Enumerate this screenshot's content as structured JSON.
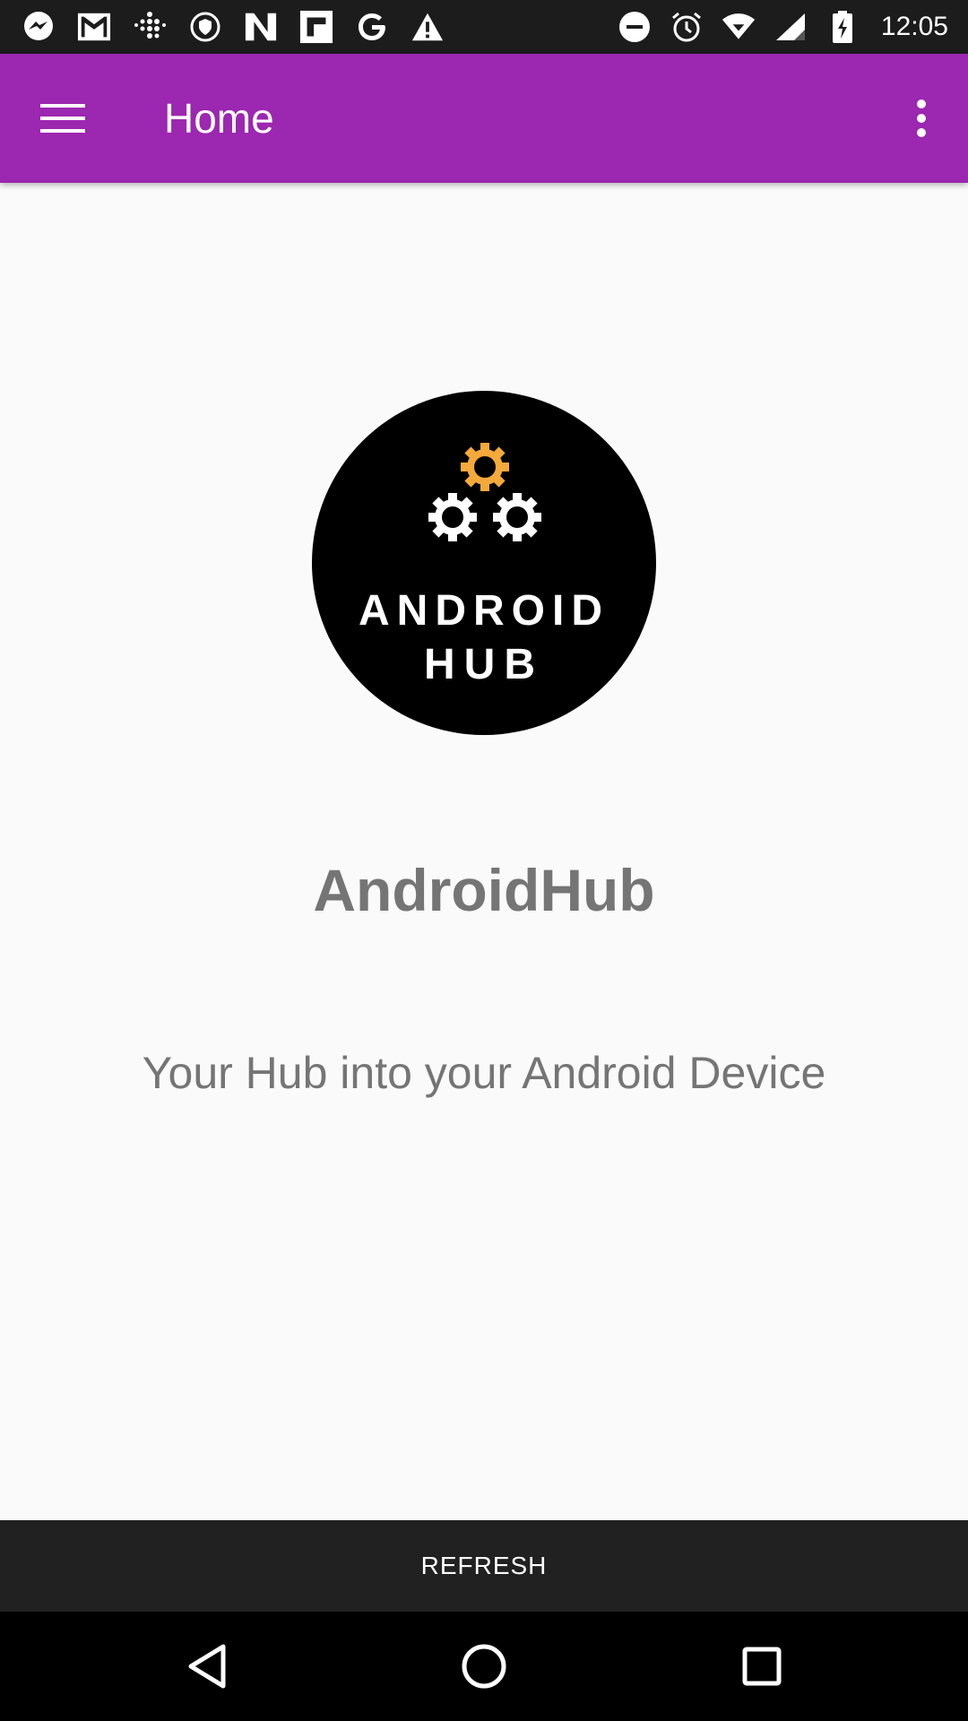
{
  "status_bar": {
    "time": "12:05",
    "left_icons": [
      "messenger-icon",
      "gmail-icon",
      "fitbit-icon",
      "vpn-shield-icon",
      "news-icon",
      "flipboard-icon",
      "google-icon",
      "warning-icon"
    ],
    "right_icons": [
      "do-not-disturb-icon",
      "alarm-icon",
      "wifi-icon",
      "signal-icon",
      "battery-icon"
    ]
  },
  "toolbar": {
    "title": "Home",
    "background_color": "#9c27b0"
  },
  "logo": {
    "line1": "ANDROID",
    "line2": "HUB",
    "gear_accent_color": "#f4a93b"
  },
  "main": {
    "app_name": "AndroidHub",
    "tagline": "Your Hub into your Android Device"
  },
  "refresh": {
    "label": "REFRESH"
  },
  "navigation": {
    "buttons": [
      "back",
      "home",
      "recents"
    ]
  }
}
